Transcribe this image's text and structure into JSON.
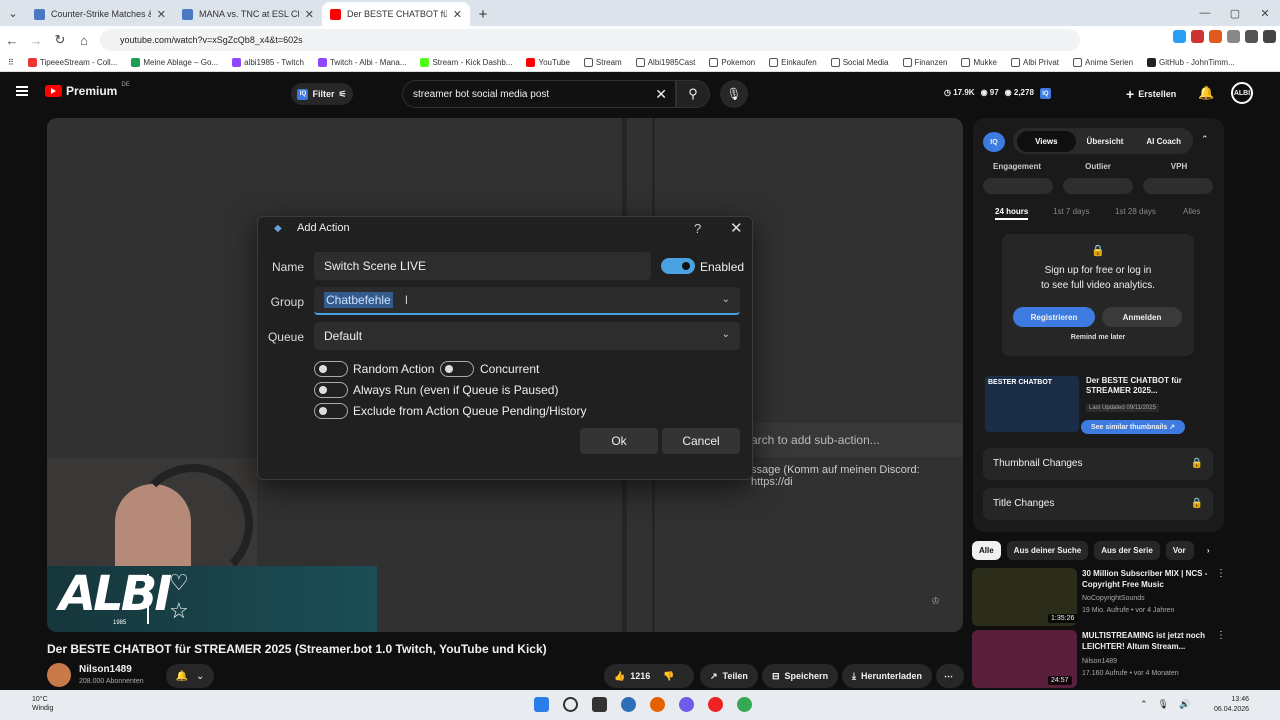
{
  "browser": {
    "tabs": [
      {
        "title": "Counter-Strike Matches & lives",
        "color": "#4a78c2"
      },
      {
        "title": "MANA vs. TNC at ESL Challeng",
        "color": "#4a78c2"
      },
      {
        "title": "Der BESTE CHATBOT für STREA",
        "color": "#ff0000"
      }
    ],
    "url": "youtube.com/watch?v=xSgZcQb8_x4&t=602s",
    "bookmarks": [
      "TipeeeStream - Coll...",
      "Meine Ablage – Go...",
      "albi1985 - Twitch",
      "Twitch - Albi - Mana...",
      "Stream - Kick Dashb...",
      "YouTube",
      "Stream",
      "Albi1985Cast",
      "Pokemon",
      "Einkaufen",
      "Social Media",
      "Finanzen",
      "Mukke",
      "Albi Privat",
      "Anime Serien",
      "GitHub - JohnTimm..."
    ]
  },
  "yt": {
    "brand": "Premium",
    "region": "DE",
    "filter": "Filter",
    "search": "streamer bot social media post",
    "stats": [
      "17.9K",
      "97",
      "2,278"
    ],
    "create": "Erstellen",
    "avatar": "ALBI"
  },
  "dialog": {
    "title": "Add Action",
    "help": "?",
    "close": "✕",
    "name_label": "Name",
    "name_value": "Switch Scene LIVE",
    "enabled_label": "Enabled",
    "group_label": "Group",
    "group_value": "Chatbefehle",
    "queue_label": "Queue",
    "queue_value": "Default",
    "opts": [
      "Random Action",
      "Concurrent",
      "Always Run (even if Queue is Paused)",
      "Exclude from Action Queue Pending/History"
    ],
    "ok": "Ok",
    "cancel": "Cancel"
  },
  "video_bg": {
    "sub_action": "arch to add sub-action...",
    "message": "ssage (Komm auf meinen Discord: https://di"
  },
  "overlay": {
    "logo": "ALBI",
    "year": "1985"
  },
  "iq": {
    "logo": "IQ",
    "tabs": [
      "Views",
      "Übersicht",
      "AI Coach"
    ],
    "cols": [
      "Engagement",
      "Outlier",
      "VPH"
    ],
    "periods": [
      "24 hours",
      "1st 7 days",
      "1st 28 days",
      "Alles"
    ],
    "lock_text1": "Sign up for free or log in",
    "lock_text2": "to see full video analytics.",
    "register": "Registrieren",
    "login": "Anmelden",
    "remind": "Remind me later",
    "thumb_label": "BESTER CHATBOT",
    "video_title": "Der BESTE CHATBOT für STREAMER 2025...",
    "updated": "Last Updated 09/11/2025",
    "similar": "See similar thumbnails ↗",
    "thumb_changes": "Thumbnail Changes",
    "title_changes": "Title Changes"
  },
  "chips": [
    "Alle",
    "Aus deiner Suche",
    "Aus der Serie",
    "Vor"
  ],
  "recs": [
    {
      "title": "30 Million Subscriber MIX | NCS - Copyright Free Music",
      "channel": "NoCopyrightSounds",
      "meta": "19 Mio. Aufrufe • vor 4 Jahren",
      "duration": "1:35:26",
      "thumb": "#2b2d1a"
    },
    {
      "title": "MULTISTREAMING ist jetzt noch LEICHTER! Altum Stream...",
      "channel": "Nilson1489",
      "meta": "17.160 Aufrufe • vor 4 Monaten",
      "duration": "24:57",
      "thumb": "#5a1f3a"
    }
  ],
  "video": {
    "title": "Der BESTE CHATBOT für STREAMER 2025 (Streamer.bot 1.0 Twitch, YouTube und Kick)",
    "channel": "Nilson1489",
    "subs": "208.000 Abonnenten",
    "likes": "1216",
    "share": "Teilen",
    "save": "Speichern",
    "download": "Herunterladen"
  },
  "taskbar": {
    "temp": "10°C",
    "weather": "Windig",
    "time": "13:46",
    "date": "06.04.2026"
  }
}
